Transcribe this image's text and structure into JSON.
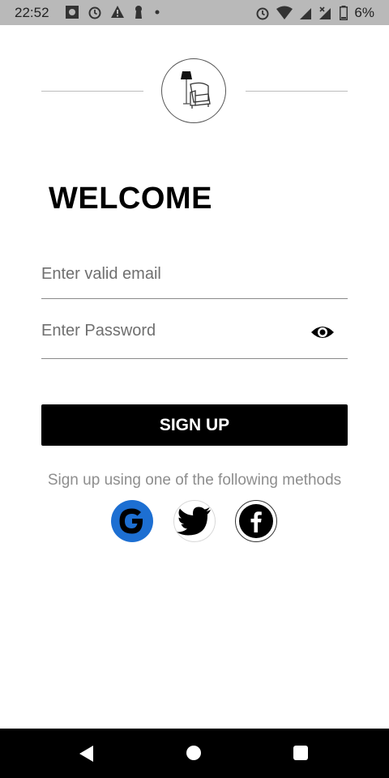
{
  "status_bar": {
    "time": "22:52",
    "battery_text": "6%",
    "left_icons": [
      "photo-icon",
      "alarm-icon",
      "warning-icon",
      "keyhole-icon",
      "dot-icon"
    ],
    "right_icons": [
      "alarm-icon",
      "wifi-icon",
      "signal-icon",
      "signal-x-icon",
      "battery-icon"
    ]
  },
  "header": {
    "logo_icon": "armchair-lamp-icon"
  },
  "main": {
    "title": "WELCOME",
    "email_placeholder": "Enter valid email",
    "password_placeholder": "Enter Password",
    "password_toggle_icon": "eye-icon",
    "signup_label": "SIGN UP",
    "methods_text": "Sign up using one of the following methods",
    "social": [
      {
        "name": "google",
        "icon": "google-icon",
        "color": "#1d6fd2"
      },
      {
        "name": "twitter",
        "icon": "twitter-icon"
      },
      {
        "name": "facebook",
        "icon": "facebook-icon"
      }
    ]
  },
  "nav_bar": {
    "icons": [
      "back-icon",
      "home-icon",
      "recents-icon"
    ]
  },
  "colors": {
    "status_bar": "#b9b9b9",
    "button": "#000000",
    "button_text": "#ffffff",
    "muted_text": "#8e8e8e"
  }
}
